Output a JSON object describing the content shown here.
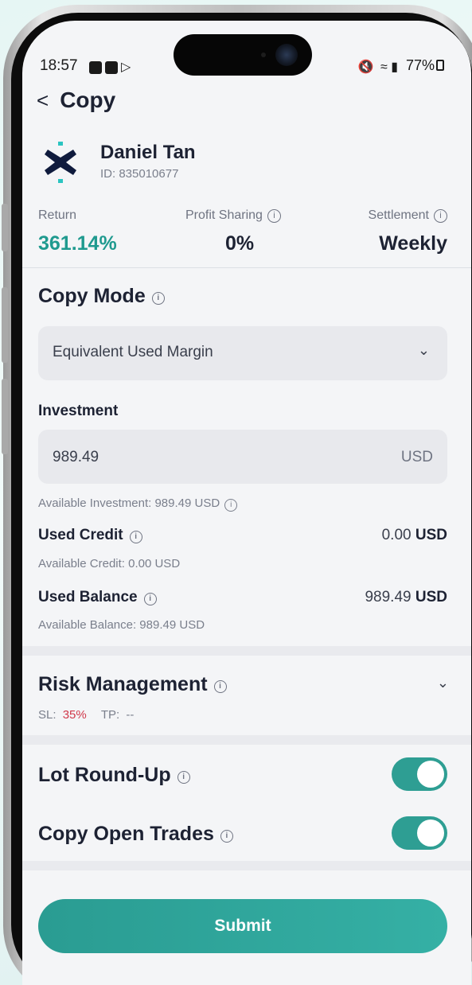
{
  "status_bar": {
    "time": "18:57",
    "right": "77%"
  },
  "header": {
    "back_icon": "chevron-left-icon",
    "title": "Copy"
  },
  "trader": {
    "name": "Daniel Tan",
    "id_label": "ID: 835010677"
  },
  "stats": [
    {
      "label": "Return",
      "value": "361.14%",
      "info": false,
      "color": "#1f9a8f"
    },
    {
      "label": "Profit Sharing",
      "value": "0%",
      "info": true,
      "color": "#1d2233"
    },
    {
      "label": "Settlement",
      "value": "Weekly",
      "info": true,
      "color": "#1d2233"
    }
  ],
  "copy_mode": {
    "title": "Copy Mode",
    "selected": "Equivalent Used Margin"
  },
  "investment": {
    "label": "Investment",
    "value": "989.49",
    "unit": "USD",
    "available": "Available Investment: 989.49 USD"
  },
  "used_credit": {
    "label": "Used Credit",
    "amount": "0.00",
    "unit": "USD",
    "available": "Available Credit: 0.00 USD"
  },
  "used_balance": {
    "label": "Used Balance",
    "amount": "989.49",
    "unit": "USD",
    "available": "Available Balance: 989.49 USD"
  },
  "risk": {
    "title": "Risk Management",
    "sl_label": "SL:",
    "sl_value": "35%",
    "tp_label": "TP:",
    "tp_value": "--",
    "sl_color": "#d0384a"
  },
  "toggles": {
    "lot_round_up": {
      "label": "Lot Round-Up",
      "on": true
    },
    "copy_open_trades": {
      "label": "Copy Open Trades",
      "on": true
    }
  },
  "submit_label": "Submit",
  "accent": "#2e9e93"
}
